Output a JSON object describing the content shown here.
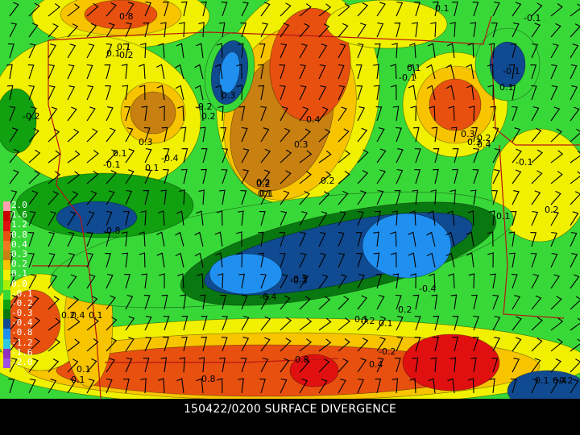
{
  "caption": "150422/0200 SURFACE DIVERGENCE",
  "legend": [
    {
      "label": "2.0",
      "color": "#ff9fb0"
    },
    {
      "label": "1.6",
      "color": "#c80000"
    },
    {
      "label": "1.2",
      "color": "#e01010"
    },
    {
      "label": "0.8",
      "color": "#e85010"
    },
    {
      "label": "0.4",
      "color": "#f07820"
    },
    {
      "label": "0.3",
      "color": "#c88010"
    },
    {
      "label": "0.2",
      "color": "#f8c400"
    },
    {
      "label": "0.1",
      "color": "#f0f000"
    },
    {
      "label": "0.0",
      "color": "#a8f000"
    },
    {
      "label": "-0.1",
      "color": "#38d838"
    },
    {
      "label": "-0.2",
      "color": "#10a010"
    },
    {
      "label": "-0.3",
      "color": "#0a7810"
    },
    {
      "label": "-0.4",
      "color": "#104a90"
    },
    {
      "label": "-0.8",
      "color": "#2090f0"
    },
    {
      "label": "-1.2",
      "color": "#30c8e0"
    },
    {
      "label": "-1.6",
      "color": "#9030c0"
    },
    {
      "label": "-2.0",
      "color": "#a050e0"
    }
  ],
  "contour_labels": [
    "0.8",
    "0.1",
    "0.2",
    "-0.2",
    "0.1",
    "-0.1",
    "0.3",
    "0.4",
    "0.2",
    "0.1",
    "-0.2",
    "0.2",
    "0.1",
    "0.1",
    "0.2",
    "0.4",
    "0.3",
    "-0.4",
    "0.1",
    "-0.1",
    "0.1",
    "-0.1",
    "-0.3",
    "-0.4",
    "0.2",
    "0.1",
    "-0.1",
    "0.2",
    "0.3",
    "0.2",
    "0.3",
    "0.4",
    "-0.8",
    "-0.3",
    "-0.4",
    "0.2",
    "0.1",
    "0.8",
    "-0.2",
    "0.1",
    "-0.1",
    "0.3",
    "0.2",
    "0.1",
    "0.8",
    "0.4",
    "0.1",
    "0.2",
    "-0.1",
    "0.1",
    "0.1",
    "0.4",
    "0.2",
    "0.1"
  ]
}
